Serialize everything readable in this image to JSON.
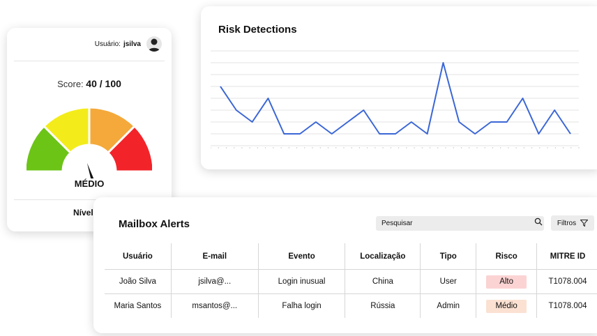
{
  "score_card": {
    "user_prefix": "Usuário:",
    "username": "jsilva",
    "score_label": "Score:",
    "score_value": "40 / 100",
    "level": "MÉDIO",
    "footer": "Nível de",
    "gauge_segments": [
      "#6cc417",
      "#f3ec1a",
      "#f4a93a",
      "#f2242a"
    ],
    "score": 40,
    "max_score": 100
  },
  "risk_detections": {
    "title": "Risk Detections",
    "chart_data": {
      "type": "line",
      "title": "Risk Detections",
      "x": [
        1,
        2,
        3,
        4,
        5,
        6,
        7,
        8,
        9,
        10,
        11,
        12,
        13,
        14,
        15,
        16,
        17,
        18,
        19,
        20,
        21,
        22,
        23
      ],
      "values": [
        5,
        3,
        2,
        4,
        1,
        1,
        2,
        1,
        2,
        3,
        1,
        1,
        2,
        1,
        7,
        2,
        1,
        2,
        2,
        4,
        1,
        3,
        1
      ],
      "ylim": [
        0,
        8
      ],
      "grid": true,
      "line_color": "#3a66d6"
    }
  },
  "mailbox_alerts": {
    "title": "Mailbox Alerts",
    "search_placeholder": "Pesquisar",
    "filters_label": "Filtros",
    "columns": [
      "Usuário",
      "E-mail",
      "Evento",
      "Localização",
      "Tipo",
      "Risco",
      "MITRE ID"
    ],
    "rows": [
      {
        "user": "João Silva",
        "email": "jsilva@...",
        "event": "Login inusual",
        "location": "China",
        "type": "User",
        "risk": "Alto",
        "mitre": "T1078.004"
      },
      {
        "user": "Maria Santos",
        "email": "msantos@...",
        "event": "Falha login",
        "location": "Rússia",
        "type": "Admin",
        "risk": "Médio",
        "mitre": "T1078.004"
      }
    ],
    "risk_colors": {
      "Alto": "#fbd3d3",
      "Médio": "#fbe1d2"
    }
  }
}
